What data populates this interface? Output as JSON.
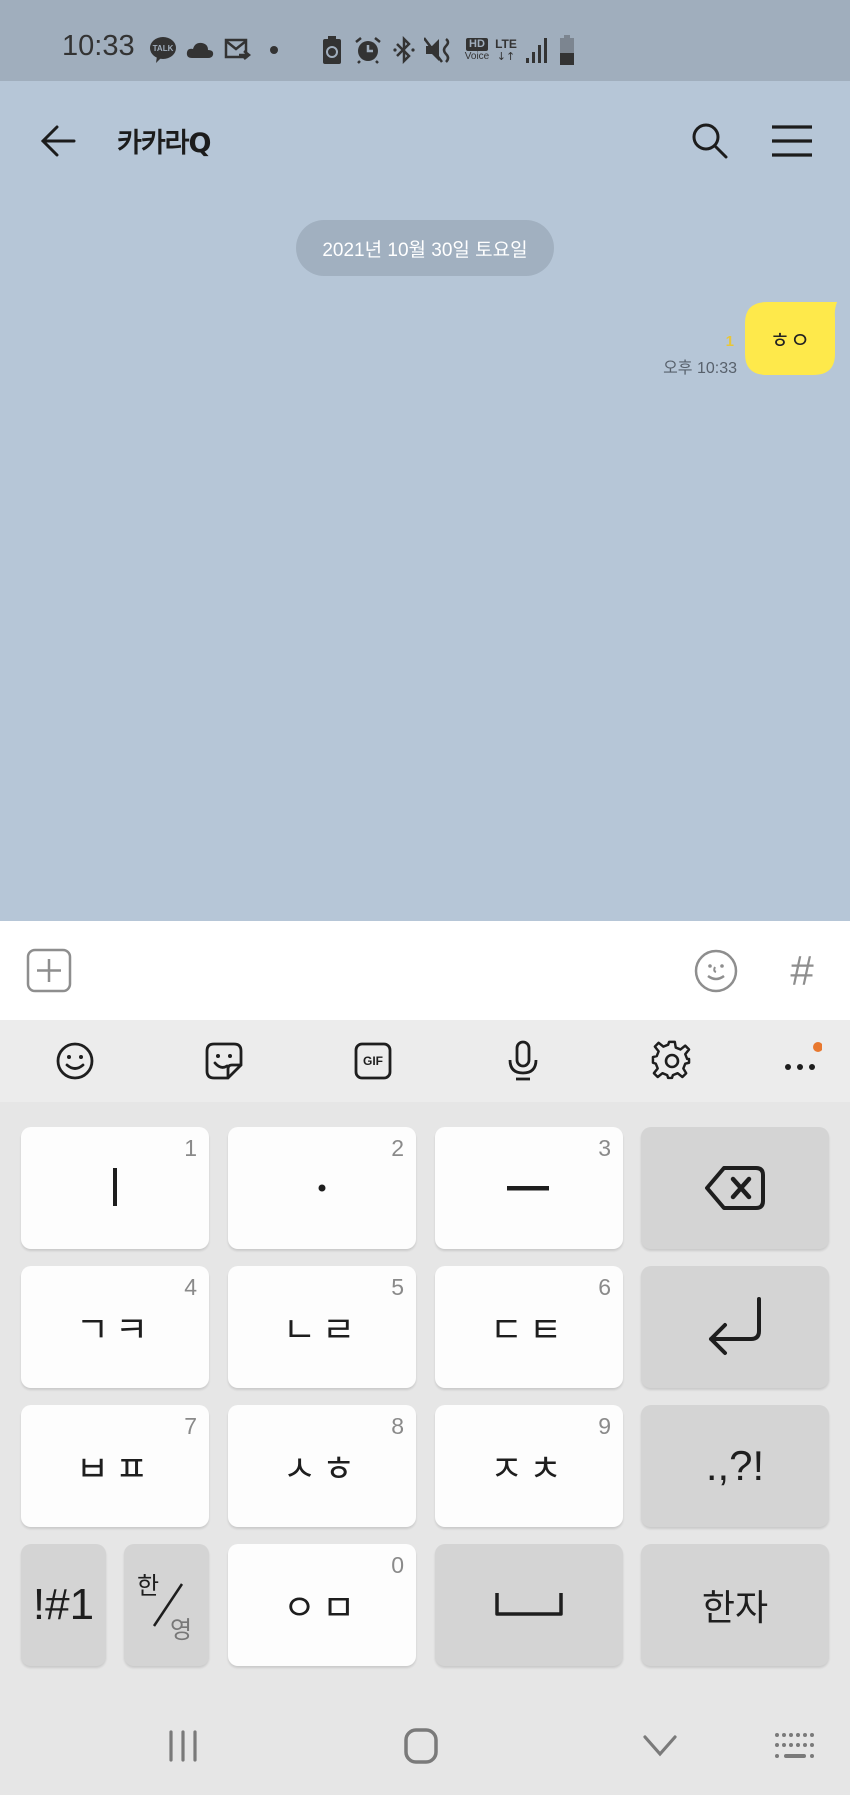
{
  "status_bar": {
    "time": "10:33",
    "icons": [
      "kakaotalk-notification",
      "cloud",
      "mail-forward",
      "dot",
      "battery-saver",
      "alarm",
      "bluetooth",
      "vibrate-mute",
      "hd-voice",
      "lte",
      "signal",
      "battery"
    ],
    "hd_label": "HD",
    "voice_label": "Voice",
    "lte_label": "LTE"
  },
  "header": {
    "title": "카카라Q",
    "back_icon": "arrow-left",
    "search_icon": "search",
    "menu_icon": "hamburger"
  },
  "chat": {
    "date_divider": "2021년 10월 30일 토요일",
    "messages": [
      {
        "sender": "me",
        "text": "ㅎㅇ",
        "unread_count": "1",
        "time": "오후 10:33",
        "bubble_color": "#fee94b"
      }
    ]
  },
  "input_bar": {
    "value": "",
    "placeholder": "",
    "plus_icon": "plus-square",
    "emoji_icon": "emoticon",
    "hash_label": "#"
  },
  "keyboard_toolbar": {
    "items": [
      "emoji",
      "sticker",
      "gif",
      "voice-input",
      "settings",
      "more"
    ],
    "gif_label": "GIF",
    "notification_dot_color": "#e8782f"
  },
  "keyboard": {
    "rows": [
      [
        {
          "label": "ㅣ",
          "num": "1"
        },
        {
          "label": "·",
          "num": "2"
        },
        {
          "label": "ㅡ",
          "num": "3"
        },
        {
          "label": "backspace"
        }
      ],
      [
        {
          "label": "ㄱㅋ",
          "num": "4"
        },
        {
          "label": "ㄴㄹ",
          "num": "5"
        },
        {
          "label": "ㄷㅌ",
          "num": "6"
        },
        {
          "label": "enter"
        }
      ],
      [
        {
          "label": "ㅂㅍ",
          "num": "7"
        },
        {
          "label": "ㅅㅎ",
          "num": "8"
        },
        {
          "label": "ㅈㅊ",
          "num": "9"
        },
        {
          "label": ".,?!"
        }
      ],
      [
        {
          "label": "!#1"
        },
        {
          "label_top": "한",
          "label_bottom": "영"
        },
        {
          "label": "ㅇㅁ",
          "num": "0"
        },
        {
          "label": "space"
        },
        {
          "label": "한자"
        }
      ]
    ]
  },
  "nav_bar": {
    "items": [
      "recents",
      "home",
      "hide-keyboard",
      "keyboard-switch"
    ]
  }
}
